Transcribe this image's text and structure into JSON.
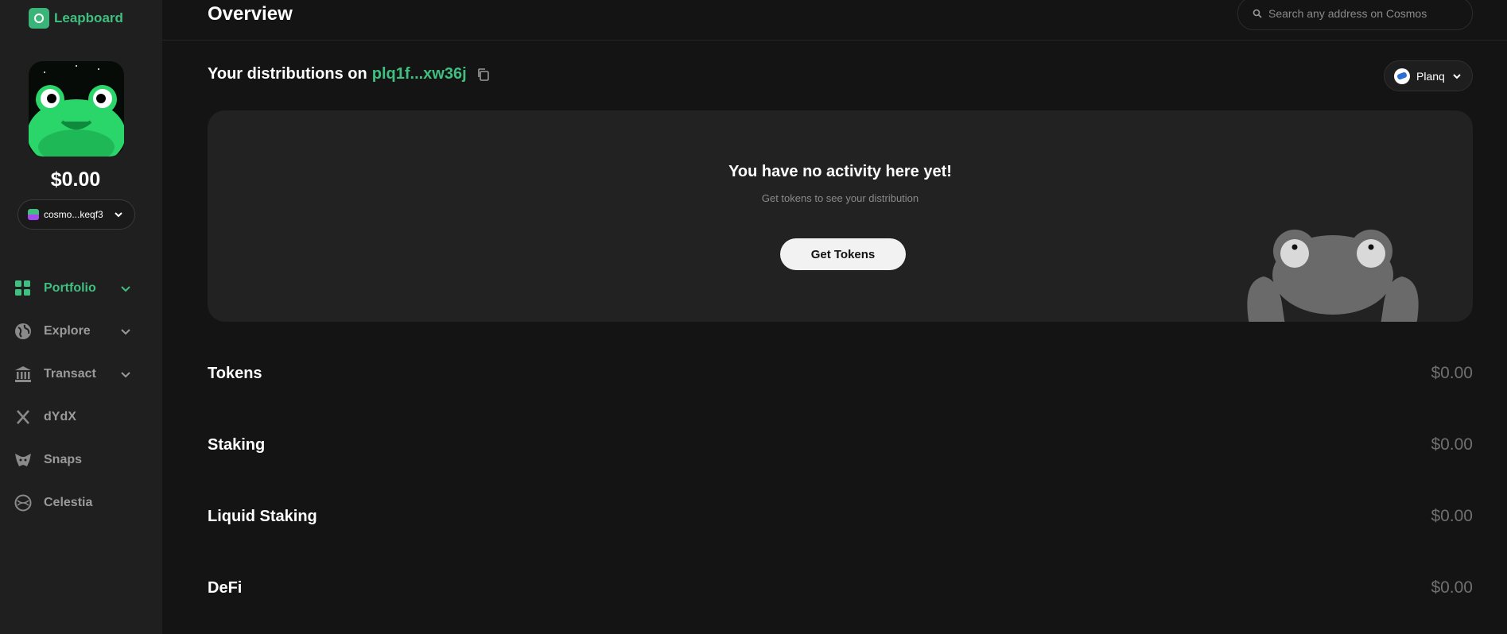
{
  "app": {
    "brand": "Leapboard",
    "accent": "#3fbf80"
  },
  "sidebar": {
    "balance": "$0.00",
    "wallet_label": "cosmo...keqf3",
    "items": [
      {
        "label": "Portfolio",
        "icon": "grid-icon",
        "active": true,
        "chevron": true
      },
      {
        "label": "Explore",
        "icon": "globe-icon",
        "active": false,
        "chevron": true
      },
      {
        "label": "Transact",
        "icon": "bank-icon",
        "active": false,
        "chevron": true
      },
      {
        "label": "dYdX",
        "icon": "dydx-x-icon",
        "active": false,
        "chevron": false
      },
      {
        "label": "Snaps",
        "icon": "metamask-fox-icon",
        "active": false,
        "chevron": false
      },
      {
        "label": "Celestia",
        "icon": "celestia-icon",
        "active": false,
        "chevron": false
      }
    ]
  },
  "header": {
    "title": "Overview",
    "search_placeholder": "Search any address on Cosmos"
  },
  "distribution": {
    "title_prefix": "Your distributions on",
    "address": "plq1f...xw36j",
    "chain": "Planq"
  },
  "empty_state": {
    "title": "You have no activity here yet!",
    "subtitle": "Get tokens to see your distribution",
    "button_label": "Get Tokens"
  },
  "sections": [
    {
      "title": "Tokens",
      "value": "$0.00"
    },
    {
      "title": "Staking",
      "value": "$0.00"
    },
    {
      "title": "Liquid Staking",
      "value": "$0.00"
    },
    {
      "title": "DeFi",
      "value": "$0.00"
    }
  ]
}
